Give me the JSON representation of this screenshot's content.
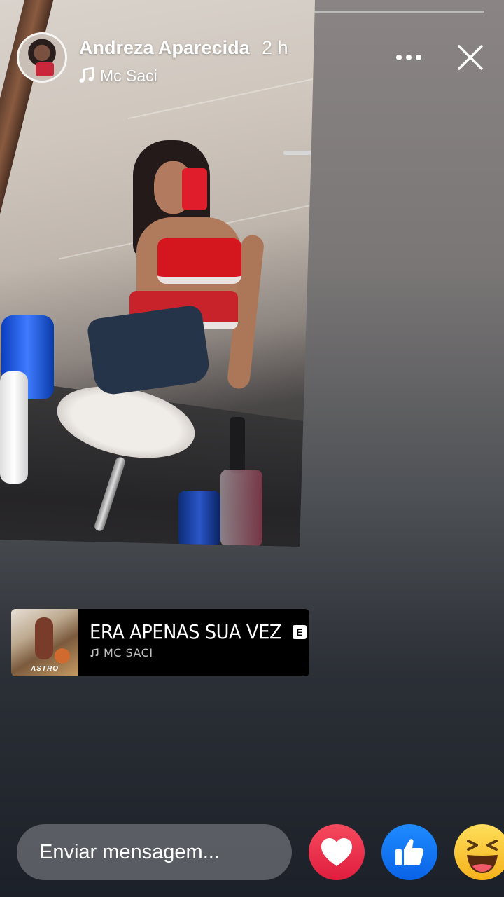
{
  "story": {
    "progress": 0.12,
    "user_name": "Andreza Aparecida",
    "time_ago": "2 h",
    "music_artist": "Mc Saci"
  },
  "music_sticker": {
    "album_label": "ASTRO",
    "song_title": "ERA APENAS SUA VEZ",
    "explicit_badge": "E",
    "artist": "MC SACI"
  },
  "bottom_bar": {
    "message_placeholder": "Enviar mensagem..."
  },
  "icons": {
    "more": "more-dots-icon",
    "close": "close-icon",
    "music_note": "music-note-icon",
    "heart": "heart-icon",
    "like": "thumbs-up-icon",
    "haha": "haha-emoji-icon"
  },
  "colors": {
    "heart": "#e01d3d",
    "like": "#0a63e6",
    "haha": "#f6b21c"
  }
}
